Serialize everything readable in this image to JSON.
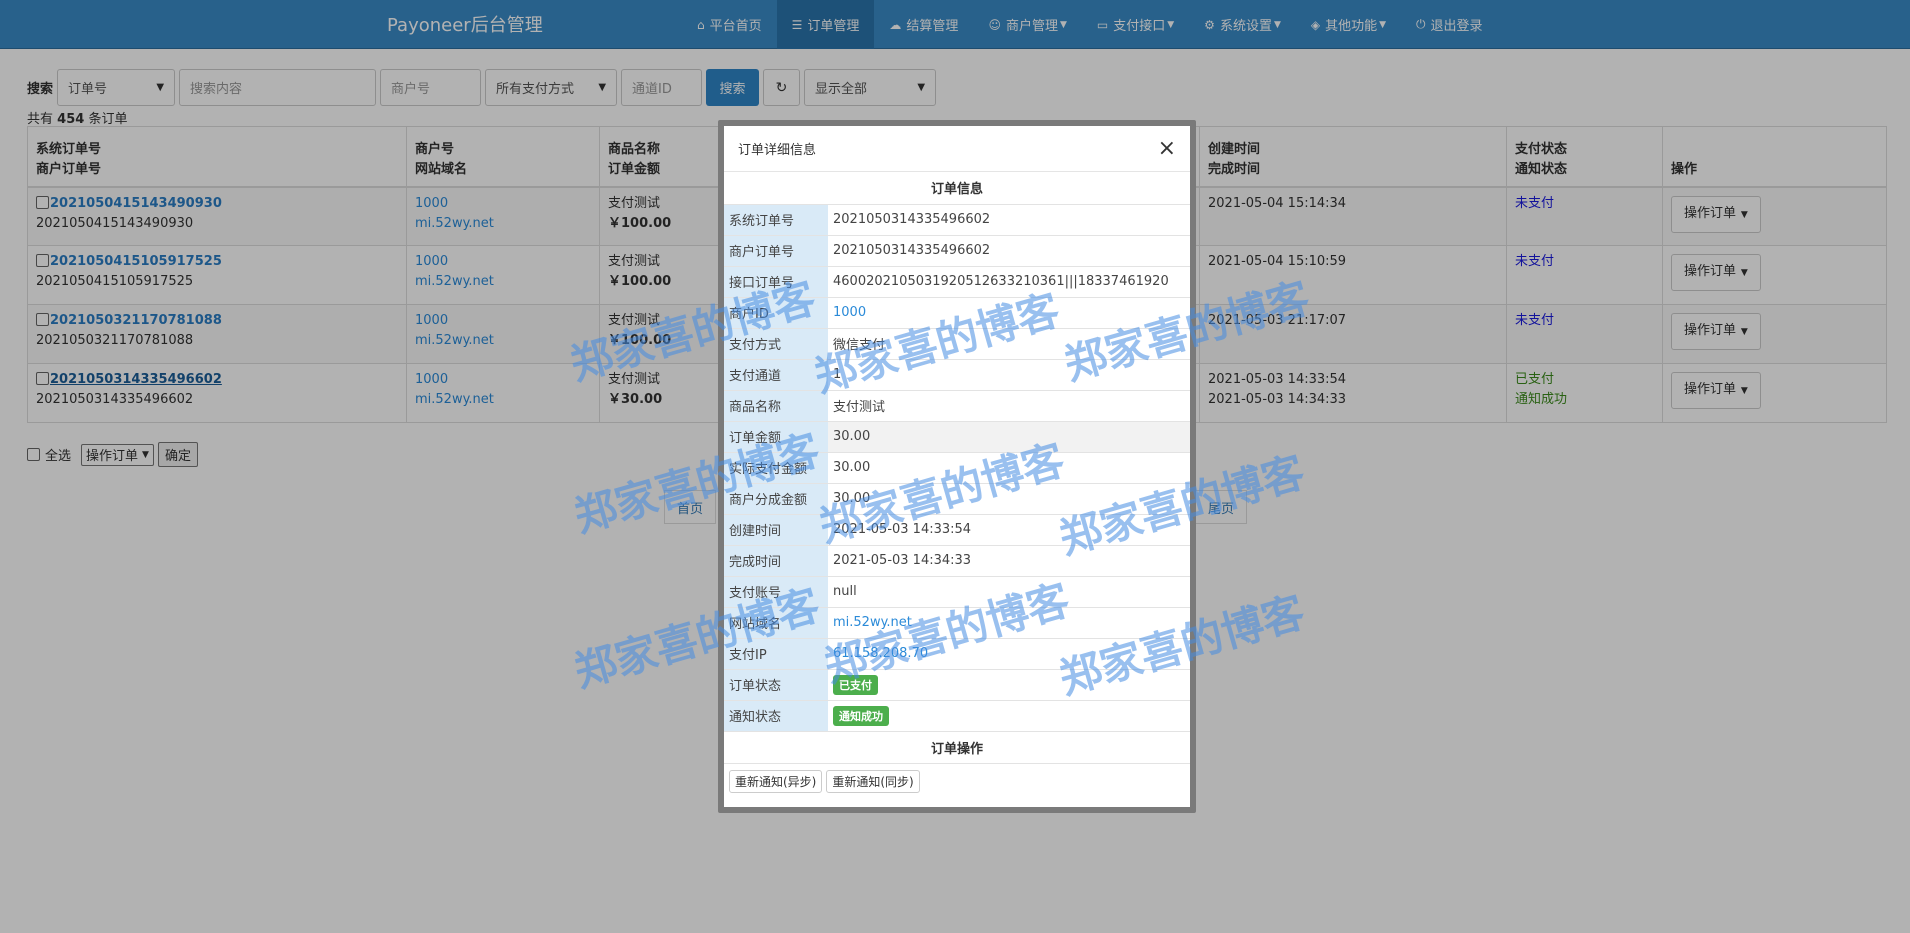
{
  "navbar": {
    "brand": "Payoneer后台管理",
    "items": [
      {
        "icon": "home-icon",
        "glyph": "⌂",
        "label": "平台首页",
        "dropdown": false,
        "active": false
      },
      {
        "icon": "list-icon",
        "glyph": "☰",
        "label": "订单管理",
        "dropdown": false,
        "active": true
      },
      {
        "icon": "cloud-icon",
        "glyph": "☁",
        "label": "结算管理",
        "dropdown": false,
        "active": false
      },
      {
        "icon": "user-icon",
        "glyph": "☺",
        "label": "商户管理",
        "dropdown": true,
        "active": false
      },
      {
        "icon": "credit-card-icon",
        "glyph": "▭",
        "label": "支付接口",
        "dropdown": true,
        "active": false
      },
      {
        "icon": "gear-icon",
        "glyph": "⚙",
        "label": "系统设置",
        "dropdown": true,
        "active": false
      },
      {
        "icon": "cube-icon",
        "glyph": "◈",
        "label": "其他功能",
        "dropdown": true,
        "active": false
      },
      {
        "icon": "power-icon",
        "glyph": "⏻",
        "label": "退出登录",
        "dropdown": false,
        "active": false
      }
    ]
  },
  "search": {
    "label": "搜索",
    "field_select": "订单号",
    "content_placeholder": "搜索内容",
    "merchant_placeholder": "商户号",
    "pay_method_select": "所有支付方式",
    "channel_placeholder": "通道ID",
    "search_button": "搜索",
    "display_select": "显示全部"
  },
  "summary": {
    "prefix": "共有",
    "count": "454",
    "suffix": "条订单"
  },
  "table": {
    "headers": {
      "col1_line1": "系统订单号",
      "col1_line2": "商户订单号",
      "col2_line1": "商户号",
      "col2_line2": "网站域名",
      "col3_line1": "商品名称",
      "col3_line2": "订单金额",
      "col5_line1": "创建时间",
      "col5_line2": "完成时间",
      "col6_line1": "支付状态",
      "col6_line2": "通知状态",
      "col7": "操作"
    },
    "rows": [
      {
        "sys_no": "2021050415143490930",
        "mch_no": "2021050415143490930",
        "mch_id": "1000",
        "domain": "mi.52wy.net",
        "product": "支付测试",
        "amount": "￥100.00",
        "created": "2021-05-04 15:14:34",
        "finished": "",
        "pay_status": "未支付",
        "notify_status": "",
        "paid": false
      },
      {
        "sys_no": "2021050415105917525",
        "mch_no": "2021050415105917525",
        "mch_id": "1000",
        "domain": "mi.52wy.net",
        "product": "支付测试",
        "amount": "￥100.00",
        "created": "2021-05-04 15:10:59",
        "finished": "",
        "pay_status": "未支付",
        "notify_status": "",
        "paid": false
      },
      {
        "sys_no": "2021050321170781088",
        "mch_no": "2021050321170781088",
        "mch_id": "1000",
        "domain": "mi.52wy.net",
        "product": "支付测试",
        "amount": "￥100.00",
        "created": "2021-05-03 21:17:07",
        "finished": "",
        "pay_status": "未支付",
        "notify_status": "",
        "paid": false
      },
      {
        "sys_no": "2021050314335496602",
        "mch_no": "2021050314335496602",
        "mch_id": "1000",
        "domain": "mi.52wy.net",
        "product": "支付测试",
        "amount": "￥30.00",
        "created": "2021-05-03 14:33:54",
        "finished": "2021-05-03 14:34:33",
        "pay_status": "已支付",
        "notify_status": "通知成功",
        "paid": true
      }
    ],
    "op_button": "操作订单"
  },
  "bulk": {
    "select_all": "全选",
    "action_select": "操作订单",
    "confirm": "确定"
  },
  "pager": {
    "first": "首页",
    "last": "尾页"
  },
  "modal": {
    "title": "订单详细信息",
    "section_info": "订单信息",
    "fields": [
      {
        "key": "系统订单号",
        "value": "2021050314335496602",
        "type": "text"
      },
      {
        "key": "商户订单号",
        "value": "2021050314335496602",
        "type": "text"
      },
      {
        "key": "接口订单号",
        "value": "4600202105031920512633210361|||18337461920",
        "type": "text"
      },
      {
        "key": "商户ID",
        "value": "1000",
        "type": "link"
      },
      {
        "key": "支付方式",
        "value": "微信支付",
        "type": "text"
      },
      {
        "key": "支付通道",
        "value": "1",
        "type": "text"
      },
      {
        "key": "商品名称",
        "value": "支付测试",
        "type": "text"
      },
      {
        "key": "订单金额",
        "value": "30.00",
        "type": "text",
        "highlight": true
      },
      {
        "key": "实际支付金额",
        "value": "30.00",
        "type": "text"
      },
      {
        "key": "商户分成金额",
        "value": "30.00",
        "type": "text"
      },
      {
        "key": "创建时间",
        "value": "2021-05-03 14:33:54",
        "type": "text"
      },
      {
        "key": "完成时间",
        "value": "2021-05-03 14:34:33",
        "type": "text"
      },
      {
        "key": "支付账号",
        "value": "null",
        "type": "text"
      },
      {
        "key": "网站域名",
        "value": "mi.52wy.net",
        "type": "link"
      },
      {
        "key": "支付IP",
        "value": "61.158.208.70",
        "type": "link"
      },
      {
        "key": "订单状态",
        "value": "已支付",
        "type": "badge"
      },
      {
        "key": "通知状态",
        "value": "通知成功",
        "type": "badge"
      }
    ],
    "section_actions": "订单操作",
    "actions": [
      "重新通知(异步)",
      "重新通知(同步)"
    ]
  },
  "watermark": "郑家喜的博客",
  "colors": {
    "navbar": "#3a8bc8",
    "primary": "#2f86c8",
    "success": "#4cae4c",
    "unpaid": "#1a1ae0"
  }
}
